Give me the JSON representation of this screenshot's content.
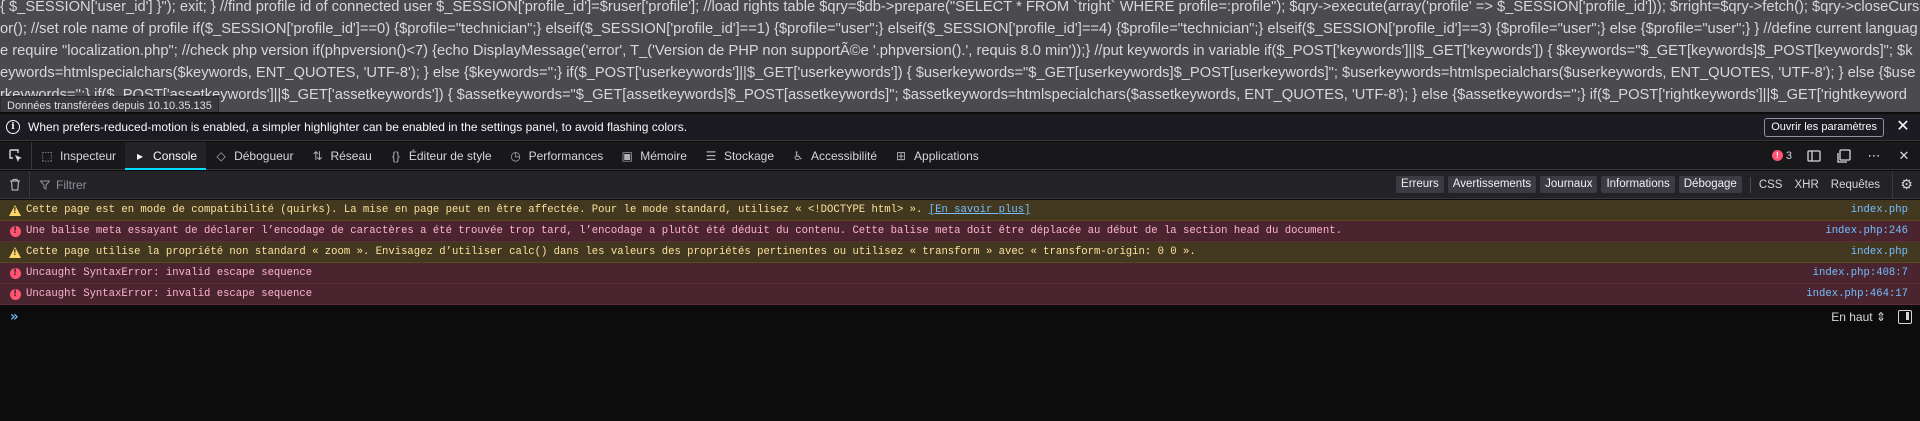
{
  "page": {
    "raw_text": "{ $_SESSION['user_id'] }\"); exit; } //find profile id of connected user $_SESSION['profile_id']=$ruser['profile']; //load rights table $qry=$db->prepare(\"SELECT * FROM `tright` WHERE profile=:profile\"); $qry->execute(array('profile' => $_SESSION['profile_id'])); $rright=$qry->fetch(); $qry->closeCursor(); //set role name of profile if($_SESSION['profile_id']==0) {$profile=\"technician\";} elseif($_SESSION['profile_id']==1) {$profile=\"user\";} elseif($_SESSION['profile_id']==4) {$profile=\"technician\";} elseif($_SESSION['profile_id']==3) {$profile=\"user\";} else {$profile=\"user\";} } //define current language require \"localization.php\"; //check php version if(phpversion()<7) {echo DisplayMessage('error', T_('Version de PHP non supportÃ©e '.phpversion().', requis 8.0 min'));} //put keywords in variable if($_POST['keywords']||$_GET['keywords']) { $keywords=\"$_GET[keywords]$_POST[keywords]\"; $keywords=htmlspecialchars($keywords, ENT_QUOTES, 'UTF-8'); } else {$keywords='';} if($_POST['userkeywords']||$_GET['userkeywords']) { $userkeywords=\"$_GET[userkeywords]$_POST[userkeywords]\"; $userkeywords=htmlspecialchars($userkeywords, ENT_QUOTES, 'UTF-8'); } else {$userkeywords='';} if($_POST['assetkeywords']||$_GET['assetkeywords']) { $assetkeywords=\"$_GET[assetkeywords]$_POST[assetkeywords]\"; $assetkeywords=htmlspecialchars($assetkeywords, ENT_QUOTES, 'UTF-8'); } else {$assetkeywords='';} if($_POST['rightkeywords']||$_GET['rightkeywords']) {",
    "transfer_tooltip": "Données transférées depuis 10.10.35.135"
  },
  "notification": {
    "message": "When prefers-reduced-motion is enabled, a simpler highlighter can be enabled in the settings panel, to avoid flashing colors.",
    "button_label": "Ouvrir les paramètres",
    "close_glyph": "✕"
  },
  "toolbar": {
    "tabs": [
      {
        "label": "Inspecteur",
        "icon": "inspector-icon",
        "active": false
      },
      {
        "label": "Console",
        "icon": "console-icon",
        "active": true
      },
      {
        "label": "Débogueur",
        "icon": "debugger-icon",
        "active": false
      },
      {
        "label": "Réseau",
        "icon": "network-icon",
        "active": false
      },
      {
        "label": "Éditeur de style",
        "icon": "style-editor-icon",
        "active": false
      },
      {
        "label": "Performances",
        "icon": "performance-icon",
        "active": false
      },
      {
        "label": "Mémoire",
        "icon": "memory-icon",
        "active": false
      },
      {
        "label": "Stockage",
        "icon": "storage-icon",
        "active": false
      },
      {
        "label": "Accessibilité",
        "icon": "accessibility-icon",
        "active": false
      },
      {
        "label": "Applications",
        "icon": "applications-icon",
        "active": false
      }
    ],
    "error_count": "3"
  },
  "filter": {
    "placeholder": "Filtrer",
    "levels": [
      "Erreurs",
      "Avertissements",
      "Journaux",
      "Informations",
      "Débogage"
    ],
    "network": [
      "CSS",
      "XHR",
      "Requêtes"
    ]
  },
  "messages": [
    {
      "level": "warning",
      "text": "Cette page est en mode de compatibilité (quirks). La mise en page peut en être affectée. Pour le mode standard, utilisez « <!DOCTYPE html> ». ",
      "link": "[En savoir plus]",
      "location": "index.php"
    },
    {
      "level": "error",
      "text": "Une balise meta essayant de déclarer l’encodage de caractères a été trouvée trop tard, l’encodage a plutôt été déduit du contenu. Cette balise meta doit être déplacée au début de la section head du document.",
      "link": "",
      "location": "index.php:246"
    },
    {
      "level": "warning",
      "text": "Cette page utilise la propriété non standard « zoom ». Envisagez d’utiliser calc() dans les valeurs des propriétés pertinentes ou utilisez « transform » avec « transform-origin: 0 0 ».",
      "link": "",
      "location": "index.php"
    },
    {
      "level": "error",
      "text": "Uncaught SyntaxError: invalid escape sequence",
      "link": "",
      "location": "index.php:408:7"
    },
    {
      "level": "error",
      "text": "Uncaught SyntaxError: invalid escape sequence",
      "link": "",
      "location": "index.php:464:17"
    }
  ],
  "console_input": {
    "prompt": "»",
    "position_label": "En haut ⇕"
  },
  "colors": {
    "accent": "#00ddff",
    "error": "#ff5572",
    "warning": "#ffd567",
    "link": "#75bfff"
  }
}
